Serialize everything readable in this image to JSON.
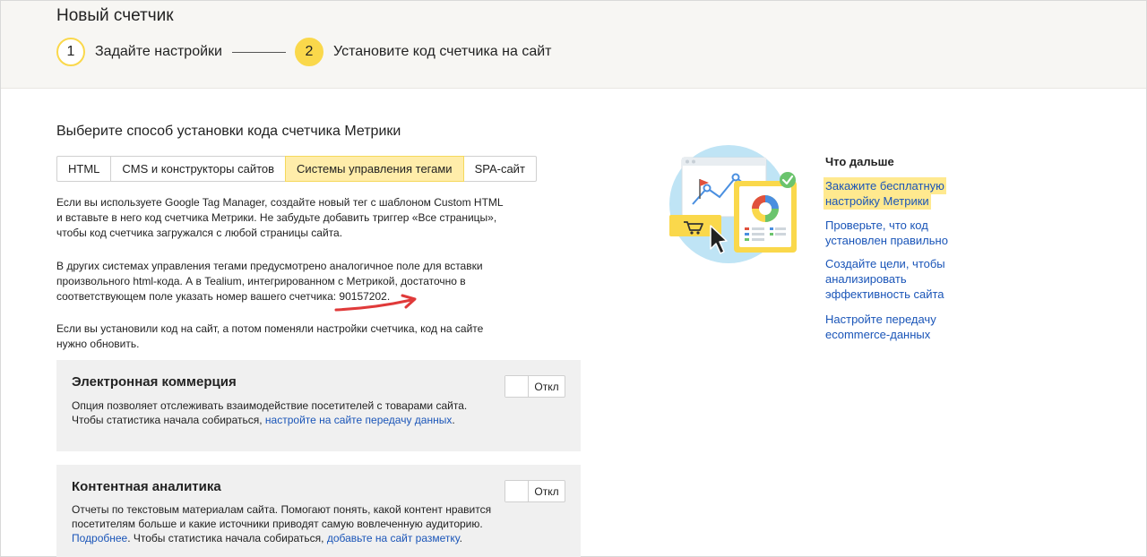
{
  "header": {
    "title": "Новый счетчик",
    "steps": [
      {
        "number": "1",
        "label": "Задайте настройки"
      },
      {
        "number": "2",
        "label": "Установите код счетчика на сайт"
      }
    ]
  },
  "install": {
    "title": "Выберите способ установки кода счетчика Метрики",
    "tabs": [
      {
        "label": "HTML"
      },
      {
        "label": "CMS и конструкторы сайтов"
      },
      {
        "label": "Системы управления тегами",
        "active": true
      },
      {
        "label": "SPA-сайт"
      }
    ],
    "paragraphs": {
      "p1_l1": "Если вы используете Google Tag Manager, создайте новый тег с шаблоном Custom HTML",
      "p1_l2": "и вставьте в него код счетчика Метрики. Не забудьте добавить триггер «Все страницы»,",
      "p1_l3": "чтобы код счетчика загружался с любой страницы сайта.",
      "p2_l1": "В других системах управления тегами предусмотрено аналогичное поле для вставки",
      "p2_l2": "произвольного html-кода. А в Tealium, интегрированном с Метрикой, достаточно в",
      "p2_l3": "соответствующем поле указать номер вашего счетчика: 90157202.",
      "p3_l1": "Если вы установили код на сайт, а потом поменяли настройки счетчика, код на сайте",
      "p3_l2": "нужно обновить."
    }
  },
  "ecommerce": {
    "title": "Электронная коммерция",
    "text_l1": "Опция позволяет отслеживать взаимодействие посетителей с товарами сайта.",
    "text_l2_prefix": "Чтобы статистика начала собираться, ",
    "text_l2_link": "настройте на сайте передачу данных",
    "text_l2_suffix": ".",
    "toggle_label": "Откл"
  },
  "content_analytics": {
    "title": "Контентная аналитика",
    "text_l1": "Отчеты по текстовым материалам сайта. Помогают понять, какой контент нравится",
    "text_l2": "посетителям больше и какие источники приводят самую вовлеченную аудиторию.",
    "text_l3_link1": "Подробнее",
    "text_l3_mid": ". Чтобы статистика начала собираться, ",
    "text_l3_link2": "добавьте на сайт разметку",
    "text_l3_suffix": ".",
    "toggle_label": "Откл"
  },
  "next_steps": {
    "title": "Что дальше",
    "links": [
      {
        "l1": "Закажите бесплатную",
        "l2": "настройку Метрики",
        "highlighted": true
      },
      {
        "l1": "Проверьте, что код",
        "l2": "установлен правильно"
      },
      {
        "l1": "Создайте цели, чтобы",
        "l2": "анализировать",
        "l3": "эффективность сайта"
      },
      {
        "l1": "Настройте передачу",
        "l2": "ecommerce-данных"
      }
    ]
  },
  "colors": {
    "accent_yellow": "#fad84b",
    "active_tab": "#ffedaa",
    "link": "#1a55b8",
    "annotation_arrow": "#e03a3a"
  }
}
